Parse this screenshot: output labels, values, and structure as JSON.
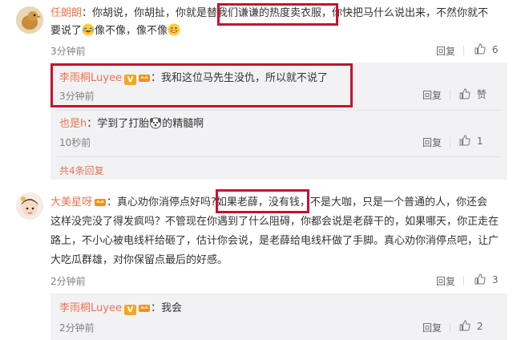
{
  "comments": [
    {
      "user": "任朗朗",
      "text_a": "：你胡说，你胡扯，你就是",
      "text_hl": "替我们谦谦的热度卖衣服",
      "text_b": "，你快把马什么说出来，不然你就不",
      "text_c": "要说了",
      "text_d": "像不像，像不像",
      "time": "3分钟前",
      "reply": "回复",
      "likes": "6",
      "replies": [
        {
          "user": "李雨桐Luyee",
          "vip": "V",
          "text": "：我和这位马先生没仇，所以就不说了",
          "time": "3分钟前",
          "reply": "回复",
          "likes": "赞"
        },
        {
          "user": "也是h",
          "text_a": "：学到了打胎",
          "text_b": "的精髓啊",
          "time": "10秒前",
          "reply": "回复",
          "likes": "1"
        }
      ],
      "more": "共4条回复"
    },
    {
      "user": "大美星呀",
      "line1_a": "：真心劝你消停点好吗?",
      "line1_hl": "如果老薛，没有钱",
      "line1_b": "，不是大咖，只是一个普通的人，你还会",
      "line2": "这样没完没了得发疯吗？不管现在你遇到了什么阻碍，你都会说是老薛干的，如果哪天，你正走在",
      "line3": "路上，不小心被电线杆给砸了，估计你会说，是老薛给电线杆做了手脚。真心劝你消停点吧，让广",
      "line4": "大吃瓜群雄，对你保留点最后的好感。",
      "time": "2分钟前",
      "reply": "回复",
      "likes": "3",
      "replies": [
        {
          "user": "李雨桐Luyee",
          "vip": "V",
          "text": "：我会",
          "time": "2分钟前",
          "reply": "回复",
          "likes": "2"
        }
      ]
    }
  ],
  "colors": {
    "name": "#eb7350",
    "highlight_box": "#c8102e",
    "reply_bg": "#f2f2f5"
  }
}
